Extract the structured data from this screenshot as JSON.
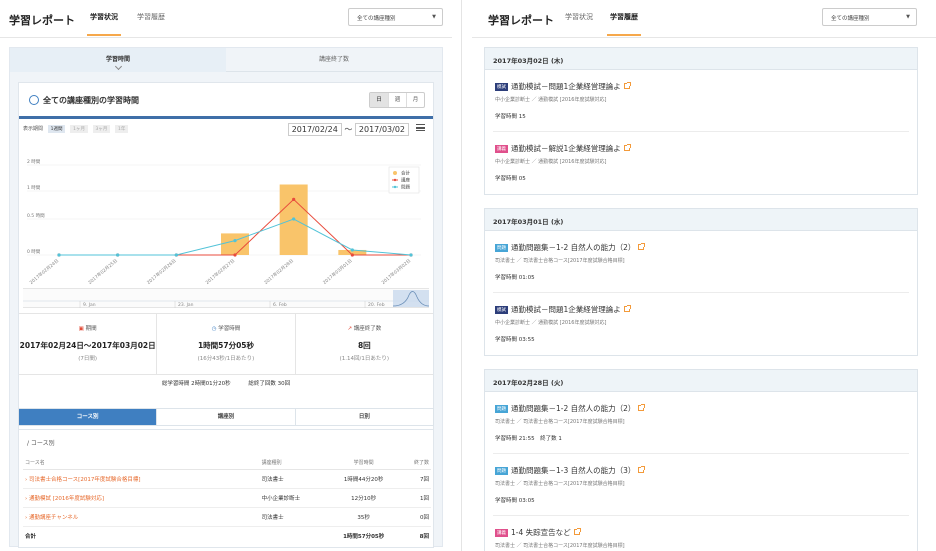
{
  "left": {
    "brand": "学習レポート",
    "tabs": [
      "学習状況",
      "学習履歴"
    ],
    "course_select": "全ての講座種別",
    "top_tabs": [
      "学習時間",
      "講座終了数"
    ],
    "card_title": "全ての講座種別の学習時間",
    "granularity": [
      "日",
      "週",
      "月"
    ],
    "period_label": "表示期間",
    "period_buttons": [
      "1週間",
      "1ヶ月",
      "3ヶ月",
      "1年"
    ],
    "date_from": "2017/02/24",
    "date_sep": "〜",
    "date_to": "2017/03/02",
    "chart_legend": [
      "合計",
      "講座",
      "問題"
    ],
    "navigator_labels": [
      "9. Jan",
      "23. Jan",
      "6. Feb",
      "20. Feb"
    ],
    "stats": [
      {
        "label": "期間",
        "value": "2017年02月24日〜2017年03月02日",
        "sub": "(7日間)"
      },
      {
        "label": "学習時間",
        "value": "1時間57分05秒",
        "sub": "(16分43秒/1日あたり)"
      },
      {
        "label": "講座終了数",
        "value": "8回",
        "sub": "(1.14回/1日あたり)"
      }
    ],
    "total_time": "総学習時間 2時間01分20秒",
    "total_done": "総終了回数 30回",
    "bottom_tabs": [
      "コース別",
      "講座別",
      "日別"
    ],
    "crumb": "/ コース別",
    "table_headers": [
      "コース名",
      "講座種別",
      "学習時間",
      "終了数"
    ],
    "table_rows": [
      {
        "name": "› 司法書士合格コース[2017年度試験合格目標]",
        "type": "司法書士",
        "time": "1時間44分20秒",
        "done": "7回"
      },
      {
        "name": "› 通勤模試 [2016年度試験対応]",
        "type": "中小企業診断士",
        "time": "12分10秒",
        "done": "1回"
      },
      {
        "name": "› 通勤講座チャンネル",
        "type": "司法書士",
        "time": "35秒",
        "done": "0回"
      }
    ],
    "table_total": {
      "label": "合計",
      "time": "1時間57分05秒",
      "done": "8回"
    }
  },
  "chart_data": {
    "type": "bar",
    "categories": [
      "02月24日",
      "02月25日",
      "02月26日",
      "02月27日",
      "02月28日",
      "03月01日",
      "03月02日"
    ],
    "ylabel": "",
    "y_ticks": [
      "0 時間",
      "0.5 時間",
      "1 時間",
      "2 時間"
    ],
    "ylim": [
      0,
      2.5
    ],
    "series": [
      {
        "name": "合計",
        "type": "bar",
        "color": "#f9c46a",
        "values": [
          0,
          0,
          0,
          0.3,
          1.25,
          0.07,
          0
        ]
      },
      {
        "name": "講座",
        "type": "line",
        "color": "#e84b3c",
        "values": [
          0,
          0,
          0,
          0,
          0.85,
          0,
          0
        ]
      },
      {
        "name": "問題",
        "type": "line",
        "color": "#52c3d8",
        "values": [
          0,
          0,
          0,
          0.2,
          0.5,
          0.07,
          0
        ]
      }
    ],
    "legend": "top-right"
  },
  "right": {
    "brand": "学習レポート",
    "tabs": [
      "学習状況",
      "学習履歴"
    ],
    "course_select": "全ての講座種別",
    "days": [
      {
        "date": "2017年03月02日 (木)",
        "items": [
          {
            "tag": "模試",
            "tagcolor": "#2d3e7a",
            "title": "通勤模試－問題1企業経営理論よ",
            "sub": "中小企業診断士 ／ 通勤模試 [2016年度試験対応]",
            "hours": "学習時間 15"
          },
          {
            "tag": "講義",
            "tagcolor": "#e0508c",
            "title": "通勤模試－解説1企業経営理論よ",
            "sub": "中小企業診断士 ／ 通勤模試 [2016年度試験対応]",
            "hours": "学習時間 05"
          }
        ]
      },
      {
        "date": "2017年03月01日 (水)",
        "items": [
          {
            "tag": "問題",
            "tagcolor": "#47a5d6",
            "title": "通勤問題集－1-2 自然人の能力（2）",
            "sub": "司法書士 ／ 司法書士合格コース[2017年度試験合格目標]",
            "hours": "学習時間 01:05"
          },
          {
            "tag": "模試",
            "tagcolor": "#2d3e7a",
            "title": "通勤模試－問題1企業経営理論よ",
            "sub": "中小企業診断士 ／ 通勤模試 [2016年度試験対応]",
            "hours": "学習時間 03:55"
          }
        ]
      },
      {
        "date": "2017年02月28日 (火)",
        "items": [
          {
            "tag": "問題",
            "tagcolor": "#47a5d6",
            "title": "通勤問題集－1-2 自然人の能力（2）",
            "sub": "司法書士 ／ 司法書士合格コース[2017年度試験合格目標]",
            "hours": "学習時間 21:55　終了数 1"
          },
          {
            "tag": "問題",
            "tagcolor": "#47a5d6",
            "title": "通勤問題集－1-3 自然人の能力（3）",
            "sub": "司法書士 ／ 司法書士合格コース[2017年度試験合格目標]",
            "hours": "学習時間 03:05"
          },
          {
            "tag": "講義",
            "tagcolor": "#e0508c",
            "title": "1-4 失踪宣告など",
            "sub": "司法書士 ／ 司法書士合格コース[2017年度試験合格目標]",
            "hours": ""
          }
        ]
      }
    ]
  }
}
